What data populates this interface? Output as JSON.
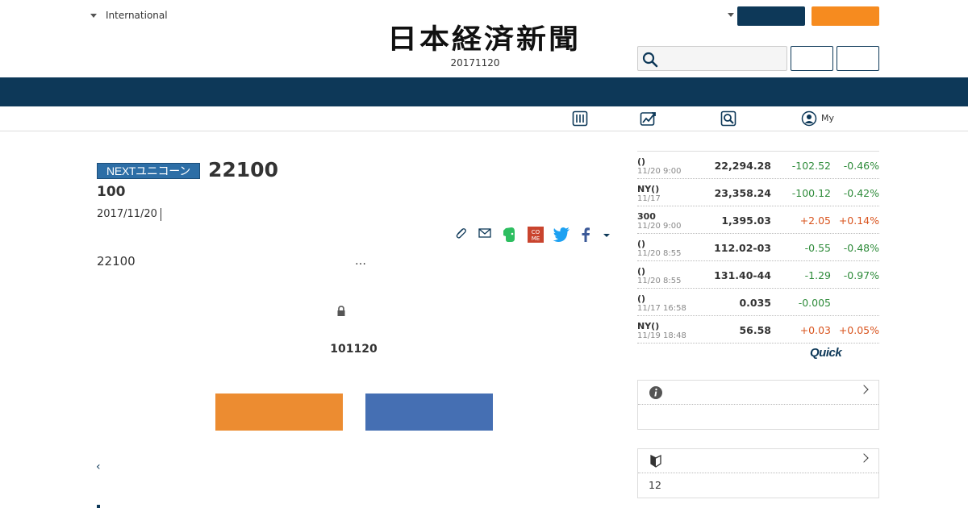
{
  "header": {
    "edition_label": "International",
    "logo_text": "日本経済新聞",
    "date": "20171120"
  },
  "subnav": {
    "my_label": "My"
  },
  "article": {
    "badge": "NEXTユニコーン",
    "title": "22100",
    "subtitle": "100",
    "date": "2017/11/20",
    "body": "22100",
    "ellipsis": "…",
    "member_notice": "101120",
    "back_symbol": "‹"
  },
  "market": {
    "rows": [
      {
        "name": "()",
        "time": "11/20 9:00",
        "value": "22,294.28",
        "change": "-102.52",
        "pct": "-0.46%"
      },
      {
        "name": "NY()",
        "time": "11/17",
        "value": "23,358.24",
        "change": "-100.12",
        "pct": "-0.42%"
      },
      {
        "name": "300",
        "time": "11/20 9:00",
        "value": "1,395.03",
        "change": "+2.05",
        "pct": "+0.14%"
      },
      {
        "name": "()",
        "time": "11/20 8:55",
        "value": "112.02-03",
        "change": "-0.55",
        "pct": "-0.48%"
      },
      {
        "name": "()",
        "time": "11/20 8:55",
        "value": "131.40-44",
        "change": "-1.29",
        "pct": "-0.97%"
      },
      {
        "name": "()",
        "time": "11/17 16:58",
        "value": "0.035",
        "change": "-0.005",
        "pct": ""
      },
      {
        "name": "NY()",
        "time": "11/19 18:48",
        "value": "56.58",
        "change": "+0.03",
        "pct": "+0.05%"
      }
    ],
    "source": "Quick",
    "colors": {
      "negative": "#2e8b3a",
      "positive": "#d9541e"
    }
  },
  "sidebar_boxes": {
    "info_body": "",
    "beginner_body": "12"
  },
  "colors": {
    "brand_navy": "#0d3858",
    "accent_orange": "#f68b1f",
    "cta_orange": "#ec8c31",
    "cta_blue": "#456fb3"
  }
}
